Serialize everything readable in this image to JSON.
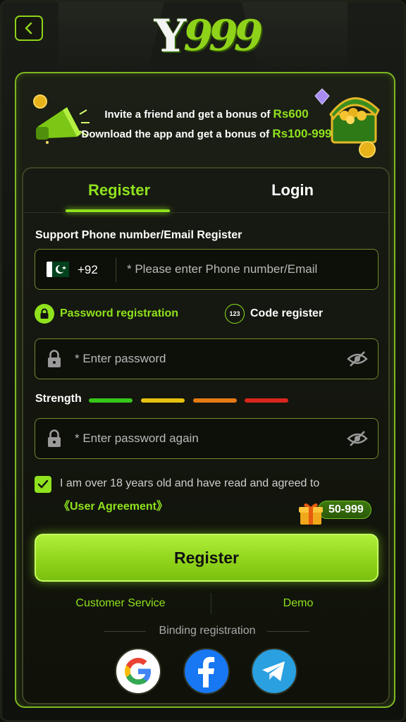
{
  "header": {
    "logo_y": "Y",
    "logo_num": "999"
  },
  "bonus": {
    "line1_prefix": "Invite a friend and get a bonus of",
    "line1_amount": "Rs600",
    "line2_prefix": "Download the app and get a bonus of",
    "line2_amount": "Rs100-999"
  },
  "tabs": {
    "register": "Register",
    "login": "Login",
    "active": "register"
  },
  "form": {
    "section_label": "Support Phone number/Email Register",
    "country_code": "+92",
    "phone_placeholder": "* Please enter Phone number/Email",
    "method_password": "Password registration",
    "method_code": "Code register",
    "method_code_badge": "123",
    "password_placeholder": "* Enter password",
    "strength_label": "Strength",
    "strength_colors": [
      "#37c61a",
      "#e7c10f",
      "#e67a14",
      "#d9261d"
    ],
    "password_again_placeholder": "* Enter password again",
    "agree_text": "I am over 18 years old and have read and agreed to",
    "agree_link": "《User Agreement》",
    "agree_checked": true,
    "gift_amount": "50-999",
    "register_button": "Register"
  },
  "footer": {
    "customer_service": "Customer Service",
    "demo": "Demo",
    "binding_label": "Binding registration",
    "social": [
      "google-icon",
      "facebook-icon",
      "telegram-icon"
    ]
  },
  "colors": {
    "accent": "#8fe21d",
    "background": "#121410"
  }
}
